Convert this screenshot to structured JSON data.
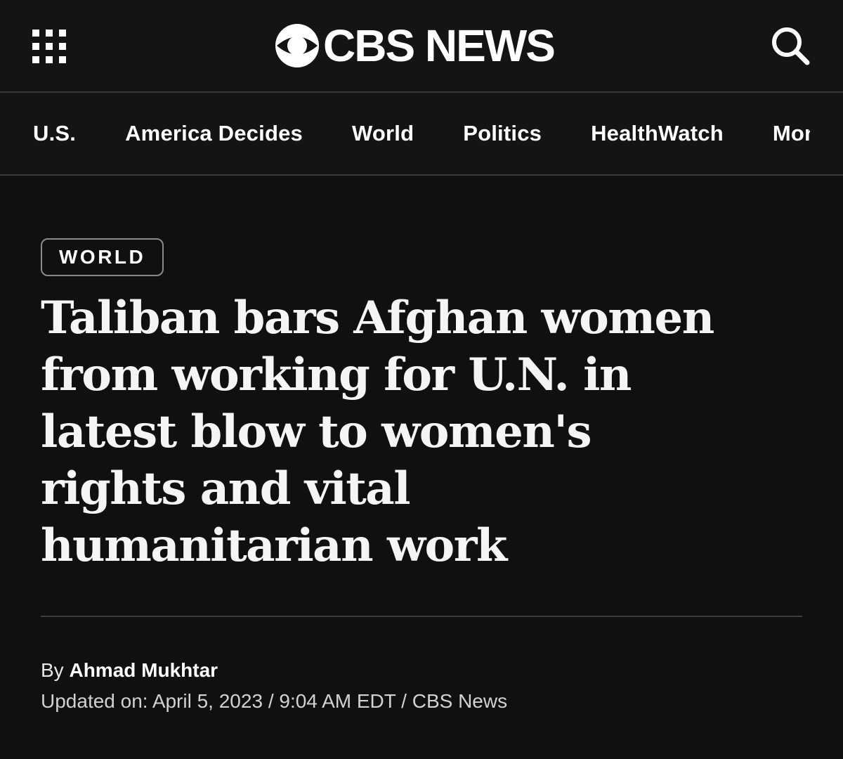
{
  "header": {
    "logo_text": "CBS NEWS",
    "menu_icon": "grid-menu-icon",
    "search_icon": "search-icon",
    "logo_icon": "cbs-eye-icon"
  },
  "nav": {
    "items": [
      "U.S.",
      "America Decides",
      "World",
      "Politics",
      "HealthWatch",
      "MoneyWatch"
    ]
  },
  "article": {
    "category": "WORLD",
    "headline": "Taliban bars Afghan women from working for U.N. in latest blow to women's rights and vital humanitarian work",
    "byline_prefix": "By",
    "author": "Ahmad Mukhtar",
    "updated_label": "Updated on:",
    "updated_date": "April 5, 2023",
    "updated_time": "9:04 AM EDT",
    "source": "CBS News"
  },
  "colors": {
    "background": "#101010",
    "text": "#ffffff",
    "divider": "#3a3a3a",
    "badge_border": "#8a8a8a"
  }
}
